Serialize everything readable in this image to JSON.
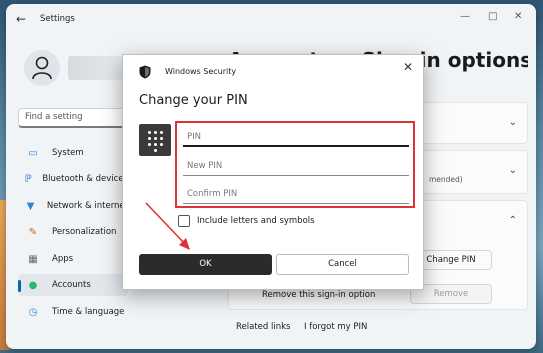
{
  "settings": {
    "title": "Settings",
    "back_icon": "back-arrow-icon",
    "page_heading": "Accounts > Sign-in options",
    "search": {
      "placeholder": "Find a setting"
    },
    "nav": [
      {
        "label": "System",
        "icon": "monitor-icon",
        "color": "#2b88d8"
      },
      {
        "label": "Bluetooth & devices",
        "icon": "bluetooth-icon",
        "color": "#1e6fd9"
      },
      {
        "label": "Network & internet",
        "icon": "wifi-icon",
        "color": "#2b88d8"
      },
      {
        "label": "Personalization",
        "icon": "brush-icon",
        "color": "#c66a1a"
      },
      {
        "label": "Apps",
        "icon": "apps-icon",
        "color": "#5a6b7d"
      },
      {
        "label": "Accounts",
        "icon": "accounts-icon",
        "color": "#2bb673",
        "active": true
      },
      {
        "label": "Time & language",
        "icon": "clock-globe-icon",
        "color": "#2b88d8"
      }
    ],
    "card2_sub": "mended)",
    "change_pin_label": "Change PIN",
    "remove_pin_text": "Remove this sign-in option",
    "remove_label": "Remove",
    "related_links_label": "Related links",
    "forgot_pin_label": "I forgot my PIN"
  },
  "dialog": {
    "source": "Windows Security",
    "title": "Change your PIN",
    "fields": [
      {
        "placeholder": "PIN"
      },
      {
        "placeholder": "New PIN"
      },
      {
        "placeholder": "Confirm PIN"
      }
    ],
    "checkbox_label": "Include letters and symbols",
    "ok_label": "OK",
    "cancel_label": "Cancel",
    "highlight_color": "#e0303a"
  }
}
